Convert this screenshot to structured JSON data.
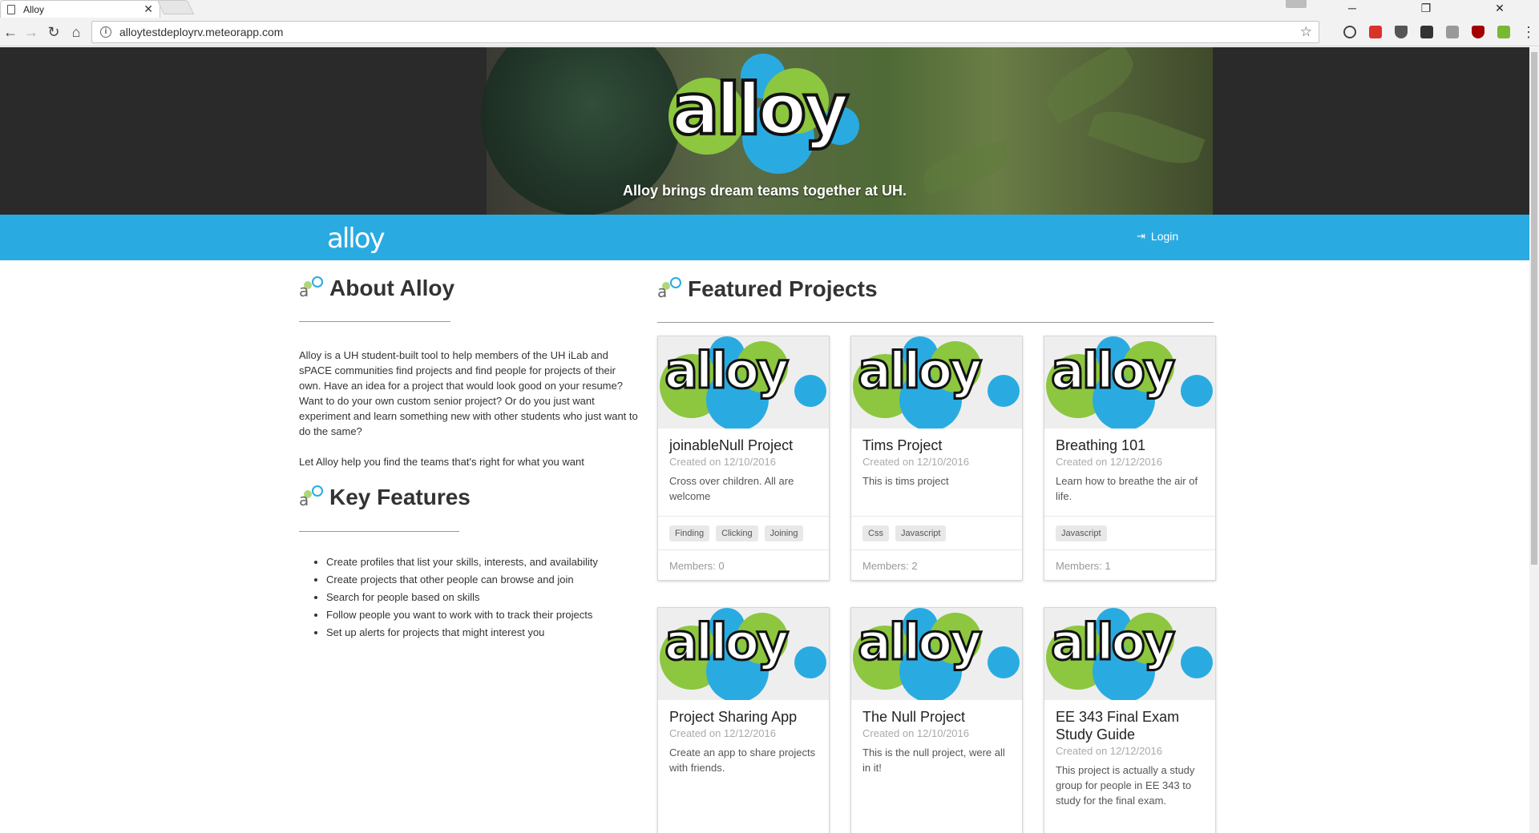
{
  "browser": {
    "tab_title": "Alloy",
    "url": "alloytestdeployrv.meteorapp.com",
    "minimize": "─",
    "restore": "❐",
    "close": "✕",
    "tab_close": "✕",
    "back": "←",
    "forward": "→",
    "reload": "↻",
    "home": "⌂",
    "star": "☆",
    "menu": "⋮",
    "info_glyph": "i"
  },
  "hero": {
    "logo_text": "alloy",
    "tagline": "Alloy brings dream teams together at UH."
  },
  "navbar": {
    "brand": "alloy",
    "login_icon": "⇥",
    "login_label": "Login",
    "accent": "#29abe2"
  },
  "about": {
    "heading": "About Alloy",
    "paragraph1": "Alloy is a UH student-built tool to help members of the UH iLab and sPACE communities find projects and find people for projects of their own. Have an idea for a project that would look good on your resume? Want to do your own custom senior project? Or do you just want experiment and learn something new with other students who just want to do the same?",
    "paragraph2": "Let Alloy help you find the teams that's right for what you want"
  },
  "key_features": {
    "heading": "Key Features",
    "items": [
      "Create profiles that list your skills, interests, and availability",
      "Create projects that other people can browse and join",
      "Search for people based on skills",
      "Follow people you want to work with to track their projects",
      "Set up alerts for projects that might interest you"
    ]
  },
  "featured": {
    "heading": "Featured Projects",
    "logo_text": "alloy",
    "projects": [
      {
        "title": "joinableNull Project",
        "created": "Created on 12/10/2016",
        "desc": "Cross over children. All are welcome",
        "tags": [
          "Finding",
          "Clicking",
          "Joining"
        ],
        "members": "Members: 0"
      },
      {
        "title": "Tims Project",
        "created": "Created on 12/10/2016",
        "desc": "This is tims project",
        "tags": [
          "Css",
          "Javascript"
        ],
        "members": "Members: 2"
      },
      {
        "title": "Breathing 101",
        "created": "Created on 12/12/2016",
        "desc": "Learn how to breathe the air of life.",
        "tags": [
          "Javascript"
        ],
        "members": "Members: 1"
      },
      {
        "title": "Project Sharing App",
        "created": "Created on 12/12/2016",
        "desc": "Create an app to share projects with friends."
      },
      {
        "title": "The Null Project",
        "created": "Created on 12/10/2016",
        "desc": "This is the null project, were all in it!"
      },
      {
        "title": "EE 343 Final Exam Study Guide",
        "created": "Created on 12/12/2016",
        "desc": "This project is actually a study group for people in EE 343 to study for the final exam."
      }
    ]
  },
  "colors": {
    "brand_blue": "#29abe2",
    "brand_green": "#8dc63f"
  }
}
